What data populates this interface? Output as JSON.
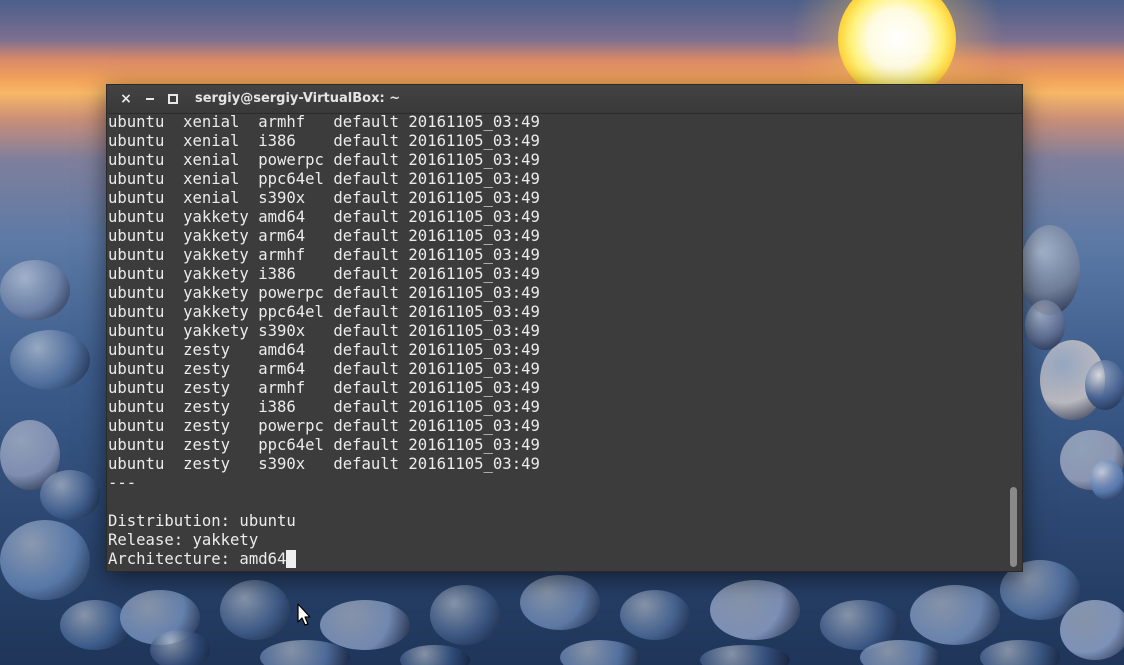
{
  "window": {
    "title": "sergiy@sergiy-VirtualBox: ~",
    "buttons": {
      "close": "×",
      "minimize": "",
      "maximize": ""
    }
  },
  "terminal": {
    "lines": [
      "ubuntu  xenial  armhf   default 20161105_03:49",
      "ubuntu  xenial  i386    default 20161105_03:49",
      "ubuntu  xenial  powerpc default 20161105_03:49",
      "ubuntu  xenial  ppc64el default 20161105_03:49",
      "ubuntu  xenial  s390x   default 20161105_03:49",
      "ubuntu  yakkety amd64   default 20161105_03:49",
      "ubuntu  yakkety arm64   default 20161105_03:49",
      "ubuntu  yakkety armhf   default 20161105_03:49",
      "ubuntu  yakkety i386    default 20161105_03:49",
      "ubuntu  yakkety powerpc default 20161105_03:49",
      "ubuntu  yakkety ppc64el default 20161105_03:49",
      "ubuntu  yakkety s390x   default 20161105_03:49",
      "ubuntu  zesty   amd64   default 20161105_03:49",
      "ubuntu  zesty   arm64   default 20161105_03:49",
      "ubuntu  zesty   armhf   default 20161105_03:49",
      "ubuntu  zesty   i386    default 20161105_03:49",
      "ubuntu  zesty   powerpc default 20161105_03:49",
      "ubuntu  zesty   ppc64el default 20161105_03:49",
      "ubuntu  zesty   s390x   default 20161105_03:49",
      "---",
      "",
      "Distribution: ubuntu",
      "Release: yakkety",
      "Architecture: amd64"
    ]
  },
  "colors": {
    "terminal_bg": "#3c3c3c",
    "terminal_text": "#ececec",
    "titlebar": "#3f3f3f"
  }
}
